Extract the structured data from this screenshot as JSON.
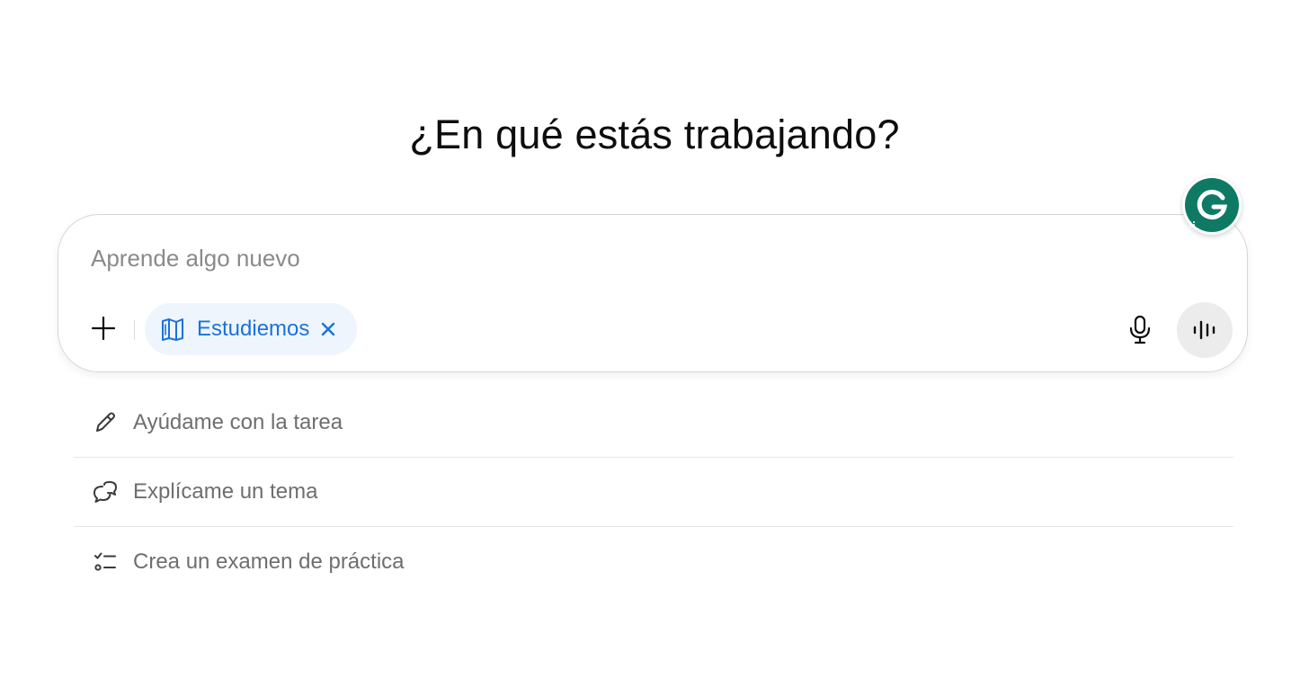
{
  "heading": "¿En qué estás trabajando?",
  "composer": {
    "placeholder": "Aprende algo nuevo",
    "value": "",
    "plus_icon": "plus-icon",
    "chip": {
      "label": "Estudiemos",
      "icon": "book-icon",
      "close_icon": "close-icon",
      "color": "#1a73d9",
      "background": "#eef5fd"
    },
    "mic_icon": "microphone-icon",
    "voice_icon": "voice-waveform-icon"
  },
  "grammarly": {
    "letter": "G",
    "color": "#0e7a64"
  },
  "suggestions": [
    {
      "icon": "pencil-icon",
      "label": "Ayúdame con la tarea"
    },
    {
      "icon": "chat-bubbles-icon",
      "label": "Explícame un tema"
    },
    {
      "icon": "checklist-icon",
      "label": "Crea un examen de práctica"
    }
  ]
}
